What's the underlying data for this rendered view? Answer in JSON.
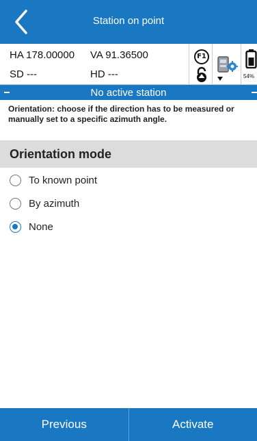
{
  "header": {
    "title": "Station on point",
    "back_icon": "chevron-left-icon"
  },
  "status": {
    "ha": "HA 178.00000",
    "va": "VA 91.36500",
    "sd": "SD ---",
    "hd": "HD ---",
    "f1_label": "F1",
    "battery_percent": "54%"
  },
  "station_bar": {
    "text": "No active station"
  },
  "instruction": "Orientation: choose if the direction has to be measured or manually set to a specific azimuth angle.",
  "orientation": {
    "title": "Orientation mode",
    "options": [
      {
        "label": "To known point",
        "checked": false
      },
      {
        "label": "By azimuth",
        "checked": false
      },
      {
        "label": "None",
        "checked": true
      }
    ]
  },
  "footer": {
    "previous": "Previous",
    "activate": "Activate"
  },
  "colors": {
    "primary": "#1a78c2",
    "section_bg": "#dcdcdc"
  }
}
